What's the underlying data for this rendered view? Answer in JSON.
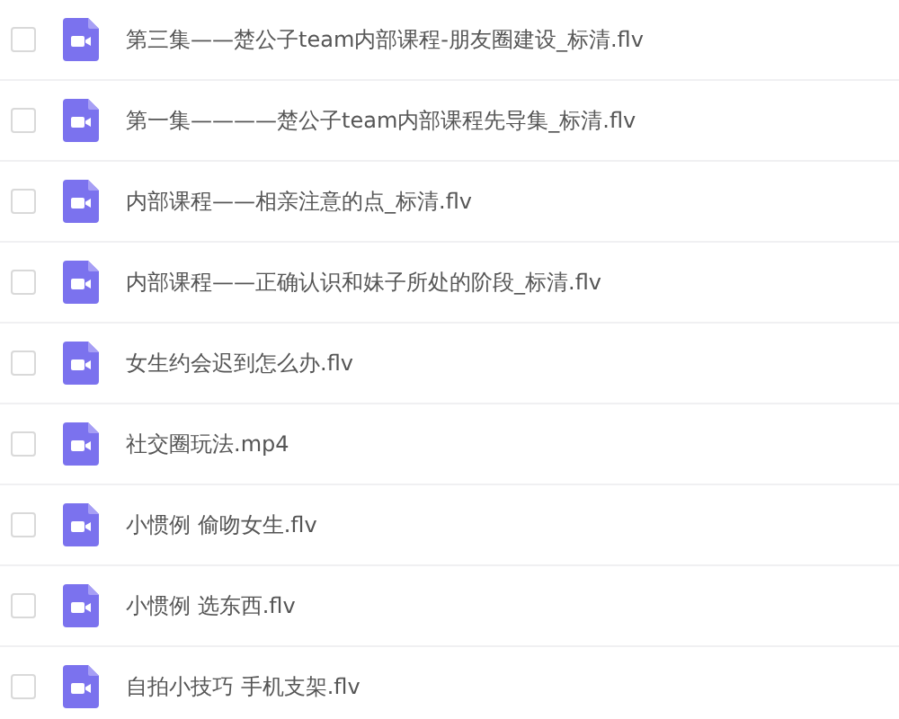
{
  "files": [
    {
      "name": "第三集——楚公子team内部课程-朋友圈建设_标清.flv",
      "checked": false
    },
    {
      "name": "第一集————楚公子team内部课程先导集_标清.flv",
      "checked": false
    },
    {
      "name": "内部课程——相亲注意的点_标清.flv",
      "checked": false
    },
    {
      "name": "内部课程——正确认识和妹子所处的阶段_标清.flv",
      "checked": false
    },
    {
      "name": "女生约会迟到怎么办.flv",
      "checked": false
    },
    {
      "name": "社交圈玩法.mp4",
      "checked": false
    },
    {
      "name": "小惯例 偷吻女生.flv",
      "checked": false
    },
    {
      "name": "小惯例 选东西.flv",
      "checked": false
    },
    {
      "name": "自拍小技巧 手机支架.flv",
      "checked": false
    }
  ]
}
